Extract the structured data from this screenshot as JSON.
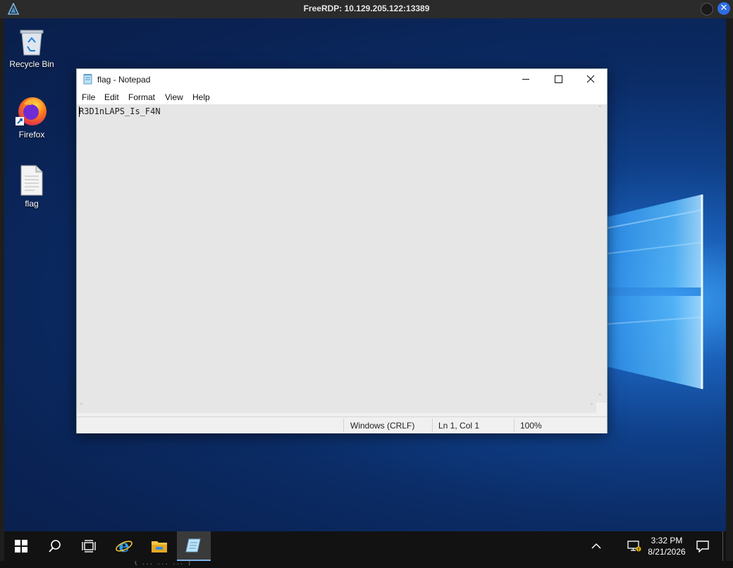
{
  "rdp": {
    "title": "FreeRDP: 10.129.205.122:13389",
    "close_glyph": "✕"
  },
  "bottom_strip_text": "{ ...    ...  ...  ]",
  "desktop": {
    "icons": [
      {
        "label": "Recycle Bin",
        "icon": "recycle-bin-icon"
      },
      {
        "label": "Firefox",
        "icon": "firefox-icon"
      },
      {
        "label": "flag",
        "icon": "text-file-icon"
      }
    ]
  },
  "notepad": {
    "title": "flag - Notepad",
    "menu": [
      "File",
      "Edit",
      "Format",
      "View",
      "Help"
    ],
    "content": "R3D1nLAPS_Is_F4N",
    "status": {
      "encoding": "Windows (CRLF)",
      "position": "Ln 1, Col 1",
      "zoom": "100%"
    }
  },
  "taskbar": {
    "items": [
      "start-icon",
      "search-icon",
      "task-view-icon",
      "internet-explorer-icon",
      "file-explorer-icon",
      "notepad-icon"
    ],
    "tray": {
      "time": "3:32 PM",
      "date": "8/21/2026"
    }
  },
  "colors": {
    "accent": "#2d6cdf",
    "taskbar": "#121212",
    "desktop": "#0b2c66"
  }
}
